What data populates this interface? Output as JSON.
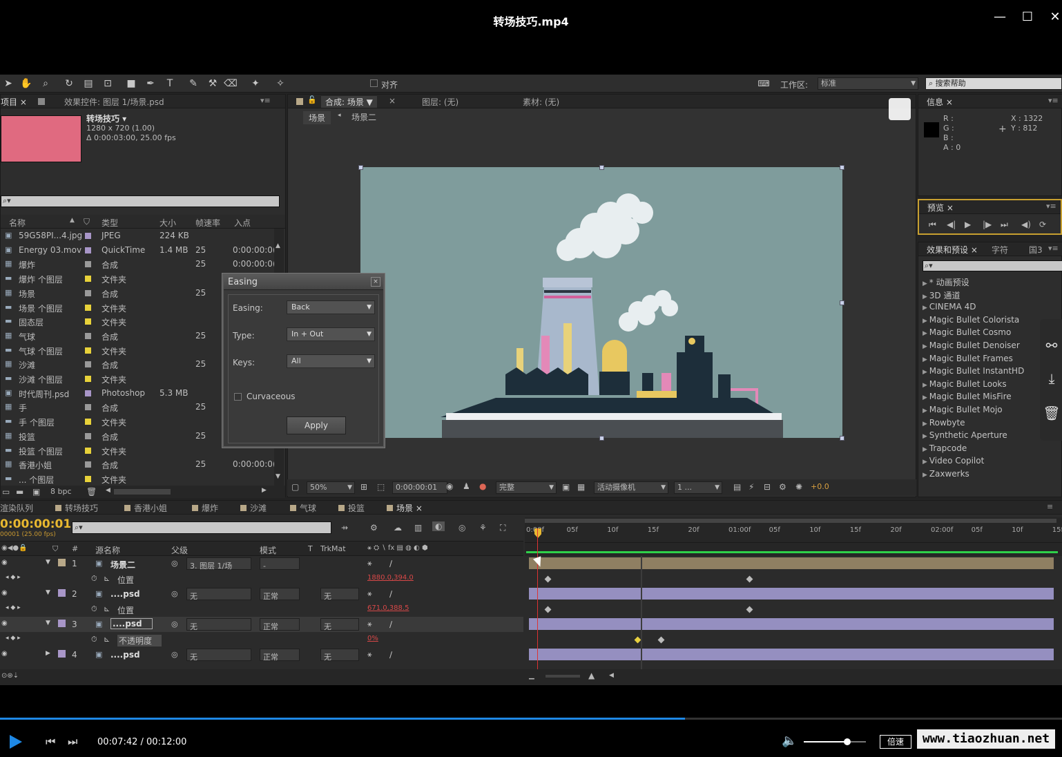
{
  "window": {
    "title": "转场技巧.mp4",
    "minimize": "—",
    "maximize": "☐",
    "close": "✕"
  },
  "toolbar": {
    "snap_label": "对齐",
    "workspace_label": "工作区:",
    "workspace_value": "标准",
    "search_placeholder": "搜索帮助"
  },
  "project_panel": {
    "tab_project": "项目",
    "tab_effects": "效果控件: 图层 1/场景.psd",
    "comp_name": "转场技巧 ▾",
    "comp_size": "1280 x 720 (1.00)",
    "comp_duration": "Δ 0:00:03:00, 25.00 fps",
    "columns": {
      "name": "名称",
      "type": "类型",
      "size": "大小",
      "fps": "帧速率",
      "in": "入点"
    },
    "items": [
      {
        "icon": "image",
        "name": "59G58PI...4.jpg",
        "color": "#a896c8",
        "type": "JPEG",
        "size": "224 KB",
        "fps": "",
        "in": ""
      },
      {
        "icon": "image",
        "name": "Energy 03.mov",
        "color": "#a896c8",
        "type": "QuickTime",
        "size": "1.4 MB",
        "fps": "25",
        "in": "0:00:00:0("
      },
      {
        "icon": "comp",
        "name": "爆炸",
        "color": "#9a9a9a",
        "type": "合成",
        "size": "",
        "fps": "25",
        "in": "0:00:00:0("
      },
      {
        "icon": "folder",
        "name": "爆炸 个图层",
        "color": "#e8d23a",
        "type": "文件夹",
        "size": "",
        "fps": "",
        "in": ""
      },
      {
        "icon": "comp",
        "name": "场景",
        "color": "#9a9a9a",
        "type": "合成",
        "size": "",
        "fps": "25",
        "in": ""
      },
      {
        "icon": "folder",
        "name": "场景 个图层",
        "color": "#e8d23a",
        "type": "文件夹",
        "size": "",
        "fps": "",
        "in": ""
      },
      {
        "icon": "folder",
        "name": "固态层",
        "color": "#e8d23a",
        "type": "文件夹",
        "size": "",
        "fps": "",
        "in": ""
      },
      {
        "icon": "comp",
        "name": "气球",
        "color": "#9a9a9a",
        "type": "合成",
        "size": "",
        "fps": "25",
        "in": ""
      },
      {
        "icon": "folder",
        "name": "气球 个图层",
        "color": "#e8d23a",
        "type": "文件夹",
        "size": "",
        "fps": "",
        "in": ""
      },
      {
        "icon": "comp",
        "name": "沙滩",
        "color": "#9a9a9a",
        "type": "合成",
        "size": "",
        "fps": "25",
        "in": ""
      },
      {
        "icon": "folder",
        "name": "沙滩 个图层",
        "color": "#e8d23a",
        "type": "文件夹",
        "size": "",
        "fps": "",
        "in": ""
      },
      {
        "icon": "image",
        "name": "时代周刊.psd",
        "color": "#a896c8",
        "type": "Photoshop",
        "size": "5.3 MB",
        "fps": "",
        "in": ""
      },
      {
        "icon": "comp",
        "name": "手",
        "color": "#9a9a9a",
        "type": "合成",
        "size": "",
        "fps": "25",
        "in": ""
      },
      {
        "icon": "folder",
        "name": "手 个图层",
        "color": "#e8d23a",
        "type": "文件夹",
        "size": "",
        "fps": "",
        "in": ""
      },
      {
        "icon": "comp",
        "name": "投篮",
        "color": "#9a9a9a",
        "type": "合成",
        "size": "",
        "fps": "25",
        "in": ""
      },
      {
        "icon": "folder",
        "name": "投篮 个图层",
        "color": "#e8d23a",
        "type": "文件夹",
        "size": "",
        "fps": "",
        "in": ""
      },
      {
        "icon": "comp",
        "name": "香港小姐",
        "color": "#9a9a9a",
        "type": "合成",
        "size": "",
        "fps": "25",
        "in": "0:00:00:0("
      },
      {
        "icon": "folder",
        "name": "... 个图层",
        "color": "#e8d23a",
        "type": "文件夹",
        "size": "",
        "fps": "",
        "in": ""
      }
    ],
    "bpc": "8 bpc"
  },
  "easing_dialog": {
    "title": "Easing",
    "easing_label": "Easing:",
    "easing_value": "Back",
    "type_label": "Type:",
    "type_value": "In + Out",
    "keys_label": "Keys:",
    "keys_value": "All",
    "curvaceous_label": "Curvaceous",
    "apply_label": "Apply"
  },
  "comp_viewer": {
    "tab_comp": "合成: 场景",
    "tab_layer": "图层: (无)",
    "tab_footage": "素材: (无)",
    "crumb_1": "场景",
    "crumb_2": "场景二",
    "zoom": "50%",
    "timecode": "0:00:00:01",
    "quality": "完整",
    "camera": "活动摄像机",
    "views": "1 ...",
    "exposure": "+0.0"
  },
  "info_panel": {
    "tab": "信息",
    "r": "R :",
    "g": "G :",
    "b": "B :",
    "a": "A : 0",
    "x": "X : 1322",
    "y": "Y : 812"
  },
  "preview_panel": {
    "tab": "预览"
  },
  "effects_panel": {
    "tab_effects": "效果和预设",
    "tab_char": "字符",
    "tab_para": "国3",
    "items": [
      "* 动画预设",
      "3D 通道",
      "CINEMA 4D",
      "Magic Bullet Colorista",
      "Magic Bullet Cosmo",
      "Magic Bullet Denoiser",
      "Magic Bullet Frames",
      "Magic Bullet InstantHD",
      "Magic Bullet Looks",
      "Magic Bullet MisFire",
      "Magic Bullet Mojo",
      "Rowbyte",
      "Synthetic Aperture",
      "Trapcode",
      "Video Copilot",
      "Zaxwerks"
    ]
  },
  "timeline": {
    "tabs": [
      "渲染队列",
      "转场技巧",
      "香港小姐",
      "爆炸",
      "沙滩",
      "气球",
      "投篮",
      "场景"
    ],
    "timecode": "0:00:00:01",
    "timecode_sub": "00001 (25.00 fps)",
    "col_source": "源名称",
    "col_parent": "父级",
    "col_mode": "模式",
    "col_t": "T",
    "col_trkmat": "TrkMat",
    "ruler": [
      "0:00f",
      "05f",
      "10f",
      "15f",
      "20f",
      "01:00f",
      "05f",
      "10f",
      "15f",
      "20f",
      "02:00f",
      "05f",
      "10f",
      "15f"
    ],
    "layers": [
      {
        "num": "1",
        "name": "场景二",
        "parent": "3. 图层 1/场",
        "mode": "-",
        "trkmat": "",
        "prop": "位置",
        "prop_value": "1880.0,394.0"
      },
      {
        "num": "2",
        "name": "....psd",
        "parent": "无",
        "mode": "正常",
        "trkmat": "无",
        "prop": "位置",
        "prop_value": "671.0,388.5"
      },
      {
        "num": "3",
        "name": "....psd",
        "parent": "无",
        "mode": "正常",
        "trkmat": "无",
        "prop": "不透明度",
        "prop_value": "0%"
      },
      {
        "num": "4",
        "name": "....psd",
        "parent": "无",
        "mode": "正常",
        "trkmat": "无",
        "prop": "",
        "prop_value": ""
      }
    ]
  },
  "player": {
    "time": "00:07:42 / 00:12:00",
    "speed_label": "倍速",
    "watermark": "www.tiaozhuan.net",
    "progress": 0.645,
    "volume": 0.7
  },
  "side_actions": [
    "share-icon",
    "download-icon",
    "delete-icon"
  ],
  "colors": {
    "accent": "#1e88e5",
    "sky": "#7f9c9c",
    "label_lavender": "#a896c8",
    "label_yellow": "#e8d23a",
    "layer_bar_tan": "#8f7f62",
    "layer_bar_lavender": "#958fc0"
  }
}
